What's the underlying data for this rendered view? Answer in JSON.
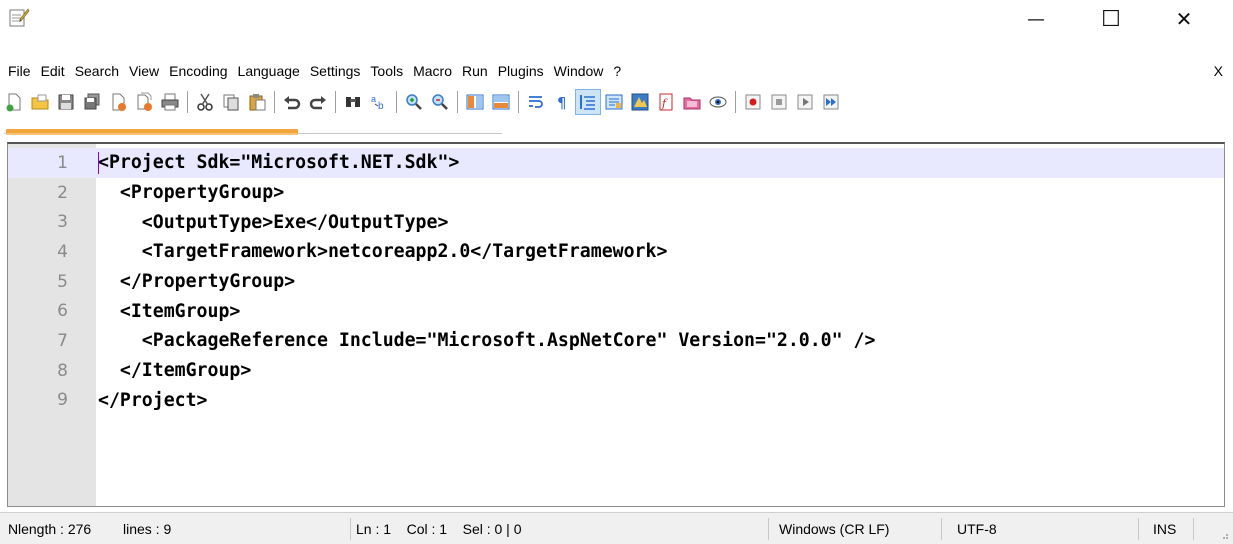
{
  "window": {
    "title": "",
    "minimize_glyph": "—",
    "maximize_glyph": "☐",
    "close_glyph": "✕"
  },
  "menu": {
    "items": [
      "File",
      "Edit",
      "Search",
      "View",
      "Encoding",
      "Language",
      "Settings",
      "Tools",
      "Macro",
      "Run",
      "Plugins",
      "Window",
      "?"
    ],
    "close_label": "X"
  },
  "toolbar": {
    "buttons": [
      "new-file-icon",
      "open-file-icon",
      "save-icon",
      "save-all-icon",
      "close-icon",
      "close-all-icon",
      "print-icon",
      "|",
      "cut-icon",
      "copy-icon",
      "paste-icon",
      "|",
      "undo-icon",
      "redo-icon",
      "|",
      "find-icon",
      "replace-icon",
      "|",
      "zoom-in-icon",
      "zoom-out-icon",
      "|",
      "sync-vertical-icon",
      "sync-horizontal-icon",
      "|",
      "word-wrap-icon",
      "show-all-chars-icon",
      "indent-guide-icon",
      "user-language-icon",
      "document-map-icon",
      "function-list-icon",
      "folder-workspace-icon",
      "monitoring-icon",
      "|",
      "macro-record-icon",
      "macro-stop-icon",
      "macro-play-icon",
      "macro-run-multiple-icon"
    ],
    "active": "indent-guide-icon"
  },
  "editor": {
    "current_line": 1,
    "lines": [
      {
        "num": "1",
        "text": "<Project Sdk=\"Microsoft.NET.Sdk\">"
      },
      {
        "num": "2",
        "text": "  <PropertyGroup>"
      },
      {
        "num": "3",
        "text": "    <OutputType>Exe</OutputType>"
      },
      {
        "num": "4",
        "text": "    <TargetFramework>netcoreapp2.0</TargetFramework>"
      },
      {
        "num": "5",
        "text": "  </PropertyGroup>"
      },
      {
        "num": "6",
        "text": "  <ItemGroup>"
      },
      {
        "num": "7",
        "text": "    <PackageReference Include=\"Microsoft.AspNetCore\" Version=\"2.0.0\" />"
      },
      {
        "num": "8",
        "text": "  </ItemGroup>"
      },
      {
        "num": "9",
        "text": "</Project>"
      }
    ]
  },
  "status": {
    "doc_type": "N",
    "length": "length : 276",
    "lines": "lines : 9",
    "position": "Ln : 1    Col : 1    Sel : 0 | 0",
    "eol": "Windows (CR LF)",
    "encoding": "UTF-8",
    "mode": "INS"
  }
}
